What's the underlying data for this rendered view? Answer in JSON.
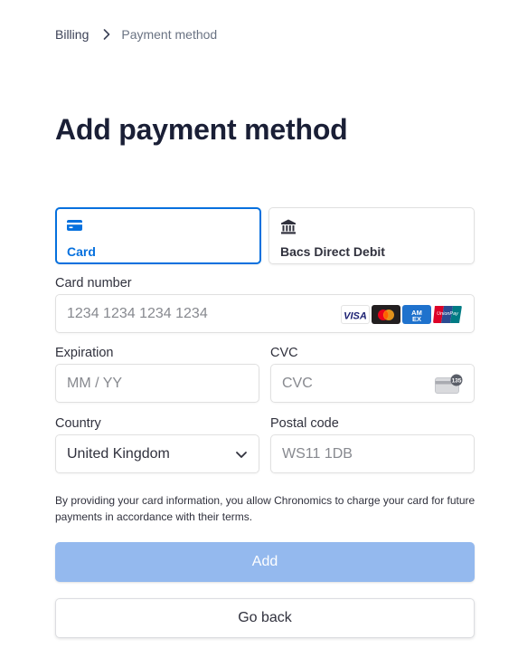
{
  "breadcrumb": {
    "parent": "Billing",
    "current": "Payment method"
  },
  "page": {
    "title": "Add payment method"
  },
  "tabs": [
    {
      "label": "Card",
      "icon": "card-icon",
      "selected": true
    },
    {
      "label": "Bacs Direct Debit",
      "icon": "bank-icon",
      "selected": false
    }
  ],
  "form": {
    "card_number": {
      "label": "Card number",
      "placeholder": "1234 1234 1234 1234",
      "value": ""
    },
    "brands": [
      "Visa",
      "Mastercard",
      "American Express",
      "UnionPay"
    ],
    "expiration": {
      "label": "Expiration",
      "placeholder": "MM / YY",
      "value": ""
    },
    "cvc": {
      "label": "CVC",
      "placeholder": "CVC",
      "value": "",
      "icon_text": "135"
    },
    "country": {
      "label": "Country",
      "value": "United Kingdom"
    },
    "postal_code": {
      "label": "Postal code",
      "placeholder": "WS11 1DB",
      "value": ""
    }
  },
  "legal_text": "By providing your card information, you allow Chronomics to charge your card for future payments in accordance with their terms.",
  "buttons": {
    "add": "Add",
    "back": "Go back"
  },
  "colors": {
    "accent": "#0570de",
    "add_button": "#94b9ee",
    "title": "#1a1f36"
  }
}
